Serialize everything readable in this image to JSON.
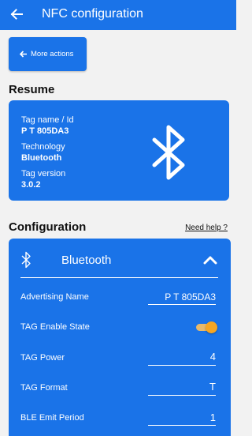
{
  "appbar": {
    "title": "NFC configuration",
    "back_icon": "arrow-left-icon"
  },
  "more_actions": {
    "label": "More actions",
    "icon": "arrow-left-icon"
  },
  "resume": {
    "section_title": "Resume",
    "tag_name_label": "Tag name / Id",
    "tag_name_value": "P T 805DA3",
    "technology_label": "Technology",
    "technology_value": "Bluetooth",
    "tag_version_label": "Tag version",
    "tag_version_value": "3.0.2",
    "icon": "bluetooth-icon"
  },
  "configuration": {
    "section_title": "Configuration",
    "help_link": "Need help ?",
    "panel": {
      "title": "Bluetooth",
      "icon": "bluetooth-icon",
      "expanded": true
    },
    "rows": [
      {
        "label": "Advertising Name",
        "value": "P T 805DA3"
      },
      {
        "label": "TAG Enable State",
        "toggle_on": true
      },
      {
        "label": "TAG Power",
        "value": "4"
      },
      {
        "label": "TAG Format",
        "value": "T"
      },
      {
        "label": "BLE Emit Period",
        "value": "1"
      }
    ]
  },
  "colors": {
    "primary": "#1a73e8",
    "background": "#f2f2f2",
    "toggle_accent": "#f5a623"
  }
}
